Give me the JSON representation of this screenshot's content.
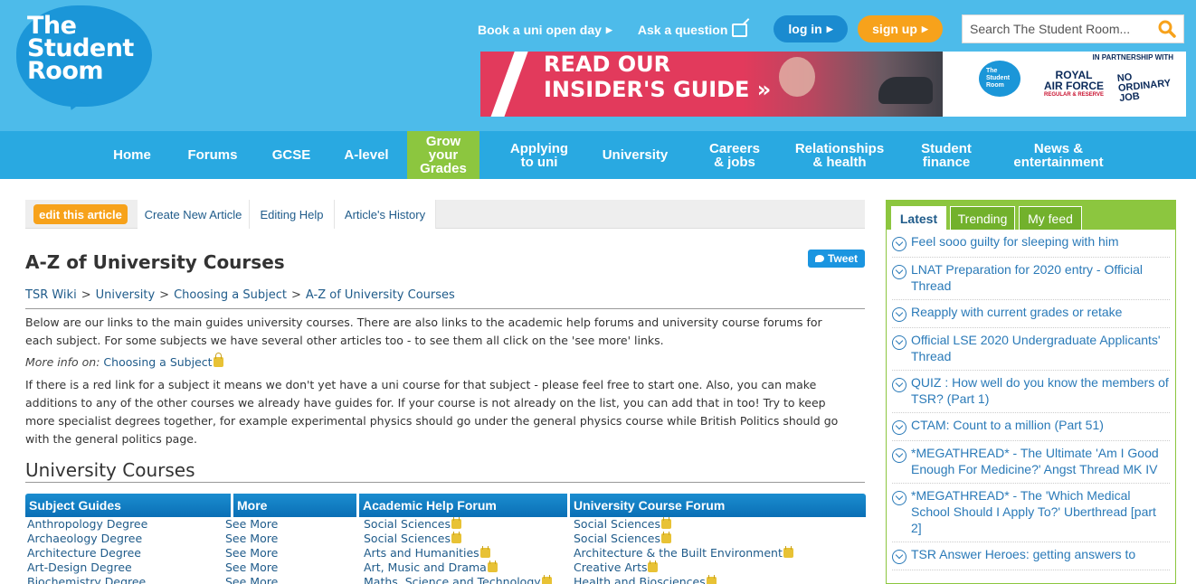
{
  "logo": {
    "line1": "The",
    "line2": "Student",
    "line3": "Room"
  },
  "toplinks": {
    "open_day": "Book a uni open day",
    "ask": "Ask a question"
  },
  "auth": {
    "login": "log in",
    "signup": "sign up"
  },
  "search": {
    "placeholder": "Search The Student Room..."
  },
  "banner": {
    "line1": "READ OUR",
    "line2": "INSIDER'S GUIDE »",
    "partner": "IN PARTNERSHIP WITH",
    "tsr_line1": "The",
    "tsr_line2": "Student",
    "tsr_line3": "Room",
    "raf_line1": "ROYAL",
    "raf_line2": "AIR FORCE",
    "raf_small": "REGULAR & RESERVE",
    "noj_line1": "NO",
    "noj_line2": "ORDINARY",
    "noj_line3": "JOB"
  },
  "nav": {
    "home": "Home",
    "forums": "Forums",
    "gcse": "GCSE",
    "alevel": "A-level",
    "grow_1": "Grow",
    "grow_2": "your",
    "grow_3": "Grades",
    "applying_1": "Applying",
    "applying_2": "to uni",
    "university": "University",
    "careers_1": "Careers",
    "careers_2": "& jobs",
    "rel_1": "Relationships",
    "rel_2": "& health",
    "finance_1": "Student",
    "finance_2": "finance",
    "news_1": "News &",
    "news_2": "entertainment"
  },
  "toolbar": {
    "edit": "edit this article",
    "create": "Create New Article",
    "help": "Editing Help",
    "history": "Article's History"
  },
  "tweet": "Tweet",
  "article": {
    "title": "A-Z of University Courses",
    "crumbs": [
      "TSR Wiki",
      "University",
      "Choosing a Subject",
      "A-Z of University Courses"
    ],
    "p1_line1": "Below are our links to the main guides university courses. There are also links to the academic help forums and university course forums for",
    "p1_line2": "each subject. For some subjects we have several other articles too - to see them all click on the 'see more' links.",
    "more_label": "More info on:",
    "more_link": "Choosing a Subject",
    "p2_line1": "If there is a red link for a subject it means we don't yet have a uni course for that subject - please feel free to start one. Also, you can make",
    "p2_line2": "additions to any of the other courses we already have guides for. If your course is not already on the list, you can add that in too! Try to keep",
    "p2_line3": "more specialist degrees together, for example experimental physics should go under the general physics course while British Politics should go",
    "p2_line4": "with the general politics page.",
    "section": "University Courses"
  },
  "table": {
    "headers": [
      "Subject Guides",
      "More",
      "Academic Help Forum",
      "University Course Forum"
    ],
    "rows": [
      [
        "Anthropology Degree",
        "See More",
        "Social Sciences",
        "Social Sciences"
      ],
      [
        "Archaeology Degree",
        "See More",
        "Social Sciences",
        "Social Sciences"
      ],
      [
        "Architecture Degree",
        "See More",
        "Arts and Humanities",
        "Architecture & the Built Environment"
      ],
      [
        "Art-Design Degree",
        "See More",
        "Art, Music and Drama",
        "Creative Arts"
      ],
      [
        "Biochemistry Degree",
        "See More",
        "Maths, Science and Technology",
        "Health and Biosciences"
      ]
    ]
  },
  "sidebar": {
    "tabs": [
      "Latest",
      "Trending",
      "My feed"
    ],
    "items": [
      "Feel sooo guilty for sleeping with him",
      "LNAT Preparation for 2020 entry - Official Thread",
      "Reapply with current grades or retake",
      "Official LSE 2020 Undergraduate Applicants' Thread",
      "QUIZ : How well do you know the members of TSR? (Part 1)",
      "CTAM: Count to a million (Part 51)",
      "*MEGATHREAD* - The Ultimate 'Am I Good Enough For Medicine?' Angst Thread MK IV",
      "*MEGATHREAD* - The 'Which Medical School Should I Apply To?' Uberthread [part 2]",
      "TSR Answer Heroes: getting answers to"
    ]
  },
  "colors": {
    "header": "#4dbbea",
    "nav": "#29a9e1",
    "accent_orange": "#f7a21b",
    "accent_green": "#8cc63f",
    "link": "#1f5b8a"
  }
}
